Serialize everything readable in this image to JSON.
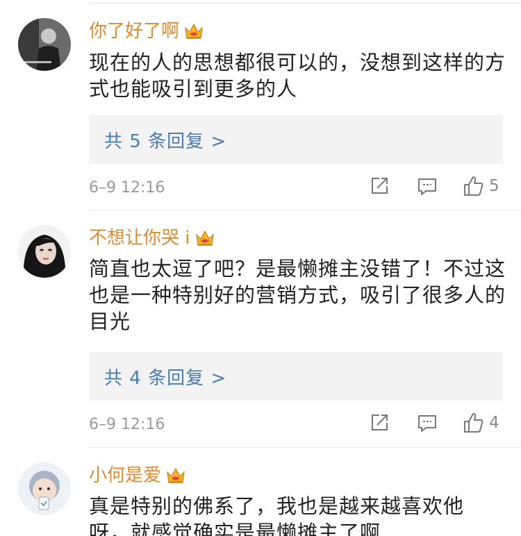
{
  "comments": [
    {
      "username": "你了好了啊",
      "text": "现在的人的思想都很可以的，没想到这样的方式也能吸引到更多的人",
      "replies_label": "共 5 条回复 >",
      "timestamp": "6–9 12:16",
      "likes": "5"
    },
    {
      "username": "不想让你哭 i",
      "text": "简直也太逗了吧？是最懒摊主没错了！不过这也是一种特别好的营销方式，吸引了很多人的目光",
      "replies_label": "共 4 条回复 >",
      "timestamp": "6–9 12:16",
      "likes": "4"
    },
    {
      "username": "小何是爱",
      "text": "真是特别的佛系了，我也是越来越喜欢他呀，就感觉确实是最懒摊主了啊"
    }
  ],
  "icons": {
    "badge": "crown-badge-icon",
    "share": "share-icon",
    "comment": "comment-icon",
    "like": "thumbs-up-icon"
  },
  "colors": {
    "username": "#e08a2f",
    "reply_link": "#4a7cb4",
    "reply_bg": "#f3f3f3",
    "timestamp": "#999999"
  }
}
